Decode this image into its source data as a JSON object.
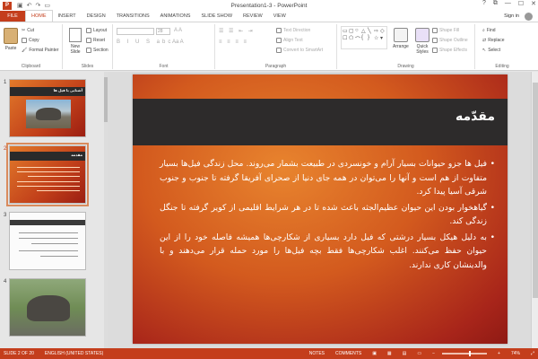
{
  "window": {
    "title": "Presentation1-3 - PowerPoint",
    "app_icon": "P",
    "quick_access": [
      "save-icon",
      "undo-icon",
      "redo-icon",
      "slideshow-icon"
    ],
    "controls": [
      "?",
      "⧉",
      "—",
      "☐",
      "✕"
    ]
  },
  "tabs": [
    "FILE",
    "HOME",
    "INSERT",
    "DESIGN",
    "TRANSITIONS",
    "ANIMATIONS",
    "SLIDE SHOW",
    "REVIEW",
    "VIEW"
  ],
  "active_tab": "HOME",
  "sign_in": "Sign in",
  "ribbon": {
    "clipboard": {
      "paste": "Paste",
      "cut": "Cut",
      "copy": "Copy",
      "format_painter": "Format Painter",
      "label": "Clipboard"
    },
    "slides": {
      "new_slide": "New Slide",
      "layout": "Layout",
      "reset": "Reset",
      "section": "Section",
      "label": "Slides"
    },
    "font": {
      "size": "28",
      "label": "Font"
    },
    "paragraph": {
      "text_direction": "Text Direction",
      "align_text": "Align Text",
      "convert": "Convert to SmartArt",
      "label": "Paragraph"
    },
    "drawing": {
      "arrange": "Arrange",
      "quick_styles": "Quick Styles",
      "shape_fill": "Shape Fill",
      "shape_outline": "Shape Outline",
      "shape_effects": "Shape Effects",
      "label": "Drawing"
    },
    "editing": {
      "find": "Find",
      "replace": "Replace",
      "select": "Select",
      "label": "Editing"
    }
  },
  "thumbnails": [
    {
      "num": "1",
      "title": "آشنایی با فیل ها"
    },
    {
      "num": "2",
      "title": "مقدمه"
    },
    {
      "num": "3",
      "title": ""
    },
    {
      "num": "4",
      "title": ""
    }
  ],
  "slide": {
    "title": "مقدّمه",
    "bullets": [
      "فیل ها جزو حیوانات بسیار آرام و خونسردی در طبیعت بشمار می‌روند. محل زندگی فیل‌ها بسیار متفاوت از هم است و آنها را می‌توان در همه جای دنیا از صحرای آفریقا گرفته تا جنوب و جنوب شرقی آسیا پیدا کرد.",
      "گیاهخوار بودن این حیوان عظیم‌الجثه باعث شده تا در هر شرایط اقلیمی از کویر گرفته تا جنگل زندگی کند.",
      "به دلیل هیکل بسیار درشتی که فیل دارد بسیاری از شکارچی‌ها همیشه فاصله خود را از این حیوان حفظ می‌کنند. اغلب شکارچی‌ها فقط بچه فیل‌ها را مورد حمله قرار می‌دهند و با والدینشان کاری ندارند."
    ]
  },
  "status": {
    "slide_info": "SLIDE 2 OF 20",
    "language": "ENGLISH (UNITED STATES)",
    "notes": "NOTES",
    "comments": "COMMENTS",
    "zoom": "74%"
  },
  "colors": {
    "accent": "#c43e1c",
    "slide_dark": "#2d2b2b",
    "slide_orange": "#d35a1e"
  }
}
